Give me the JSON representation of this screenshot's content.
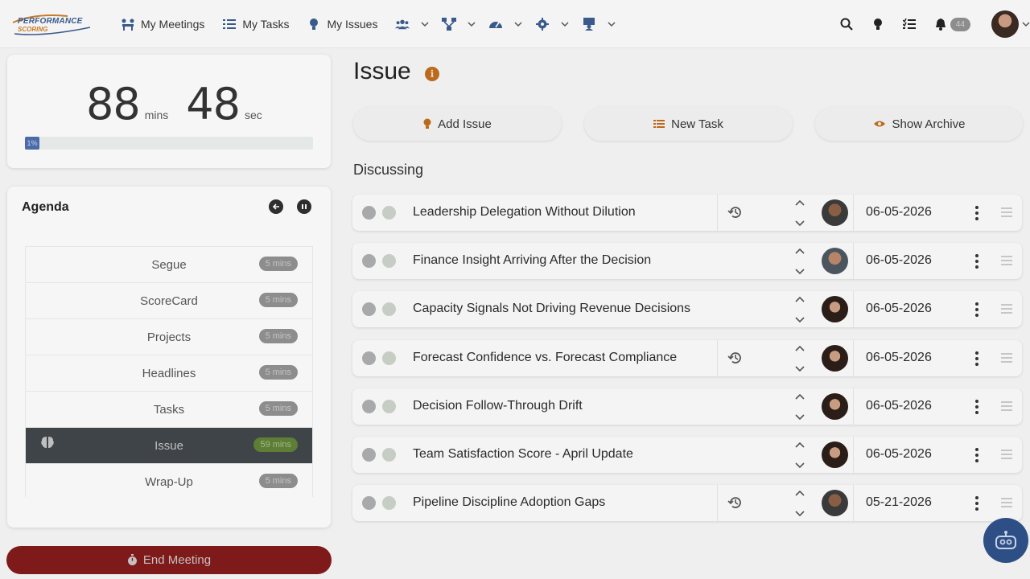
{
  "logo": {
    "line1": "PERFORMANCE",
    "line2": "SCORING"
  },
  "nav": {
    "items": [
      {
        "label": "My Meetings",
        "icon": "meetings-icon"
      },
      {
        "label": "My Tasks",
        "icon": "tasks-icon"
      },
      {
        "label": "My Issues",
        "icon": "lightbulb-icon"
      }
    ],
    "dropdowns": [
      "users-icon",
      "org-chart-icon",
      "dashboard-icon",
      "gear-icon",
      "training-icon"
    ]
  },
  "toolbar": {
    "notification_count": "44"
  },
  "timer": {
    "minutes": "88",
    "minutes_unit": "mins",
    "seconds": "48",
    "seconds_unit": "sec",
    "progress_label": "1%",
    "progress_fraction": 0.01
  },
  "agenda": {
    "title": "Agenda",
    "items": [
      {
        "label": "Segue",
        "mins": "5 mins"
      },
      {
        "label": "ScoreCard",
        "mins": "5 mins"
      },
      {
        "label": "Projects",
        "mins": "5 mins"
      },
      {
        "label": "Headlines",
        "mins": "5 mins"
      },
      {
        "label": "Tasks",
        "mins": "5 mins"
      },
      {
        "label": "Issue",
        "mins": "59 mins",
        "active": true
      },
      {
        "label": "Wrap-Up",
        "mins": "5 mins"
      }
    ]
  },
  "end_meeting": {
    "label": "End Meeting"
  },
  "main": {
    "title": "Issue",
    "actions": {
      "add_issue": "Add Issue",
      "new_task": "New Task",
      "show_archive": "Show Archive"
    },
    "section": "Discussing",
    "issues": [
      {
        "title": "Leadership Delegation Without Dilution",
        "date": "06-05-2026",
        "history": true,
        "avatar": "male-1"
      },
      {
        "title": "Finance Insight Arriving After the Decision",
        "date": "06-05-2026",
        "history": false,
        "avatar": "male-2"
      },
      {
        "title": "Capacity Signals Not Driving Revenue Decisions",
        "date": "06-05-2026",
        "history": false,
        "avatar": "female"
      },
      {
        "title": "Forecast Confidence vs. Forecast Compliance",
        "date": "06-05-2026",
        "history": true,
        "avatar": "female"
      },
      {
        "title": "Decision Follow-Through Drift",
        "date": "06-05-2026",
        "history": false,
        "avatar": "female"
      },
      {
        "title": "Team Satisfaction Score - April Update",
        "date": "06-05-2026",
        "history": false,
        "avatar": "female"
      },
      {
        "title": "Pipeline Discipline Adoption Gaps",
        "date": "05-21-2026",
        "history": true,
        "avatar": "male-1"
      }
    ]
  },
  "colors": {
    "brand_blue": "#2e4f86",
    "end_meeting_red": "#7e1a1a",
    "accent_orange": "#bb6a1c",
    "active_green": "#5d7e34"
  }
}
